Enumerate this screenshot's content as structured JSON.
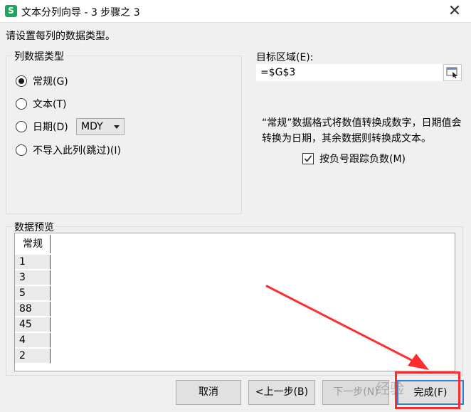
{
  "window": {
    "app_icon_letter": "S",
    "title": "文本分列向导 - 3 步骤之 3",
    "close_glyph": "✕"
  },
  "instruction": "请设置每列的数据类型。",
  "column_type": {
    "group_title": "列数据类型",
    "options": [
      {
        "label": "常规(G)",
        "selected": true
      },
      {
        "label": "文本(T)",
        "selected": false
      },
      {
        "label": "日期(D)",
        "selected": false
      },
      {
        "label": "不导入此列(跳过)(I)",
        "selected": false
      }
    ],
    "date_format": "MDY"
  },
  "destination": {
    "label": "目标区域(E):",
    "value": "=$G$3",
    "button_icon": "range-select-icon"
  },
  "description": "“常规”数据格式将数值转换成数字，日期值会转换为日期，其余数据则转换成文本。",
  "negative_option": {
    "label": "按负号跟踪负数(M)",
    "checked": true
  },
  "preview": {
    "group_title": "数据预览",
    "header": "常规",
    "rows": [
      "1",
      "3",
      "5",
      "88",
      "45",
      "4",
      "2"
    ]
  },
  "buttons": {
    "cancel": "取消",
    "back": "<上一步(B)",
    "next": "下一步(N)",
    "finish": "完成(F)"
  },
  "watermark": "经验",
  "colors": {
    "annotation_red": "#ff2d2d",
    "focus_blue": "#2f7fd8",
    "app_green": "#1fa65a"
  }
}
